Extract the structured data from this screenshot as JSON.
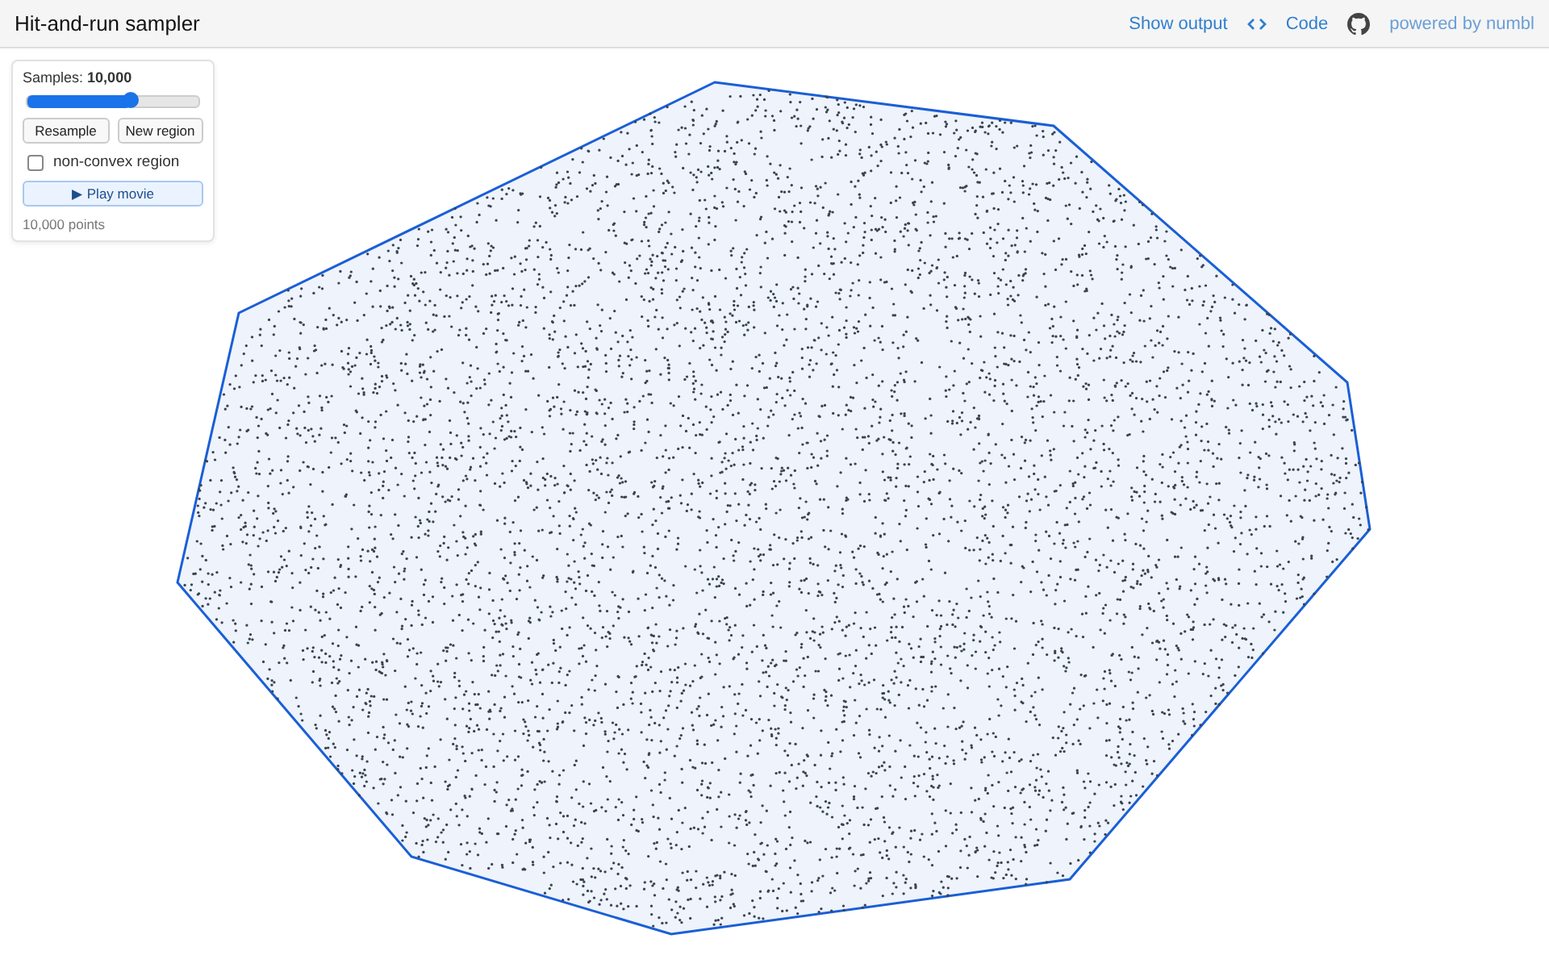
{
  "header": {
    "title": "Hit-and-run sampler",
    "links": [
      {
        "kind": "output",
        "label": "Show output"
      },
      {
        "kind": "code",
        "label": "Code"
      },
      {
        "kind": "github",
        "label": "powered by numbl"
      }
    ]
  },
  "controls": {
    "samples_label": "Samples:",
    "samples_value": "10,000",
    "slider": {
      "level": 0.6
    },
    "buttons": [
      "Resample",
      "New region"
    ],
    "non_convex": {
      "label": "non-convex region",
      "checked": false
    },
    "play_button": "▶ Play movie",
    "point_count": "10,000 points"
  }
}
